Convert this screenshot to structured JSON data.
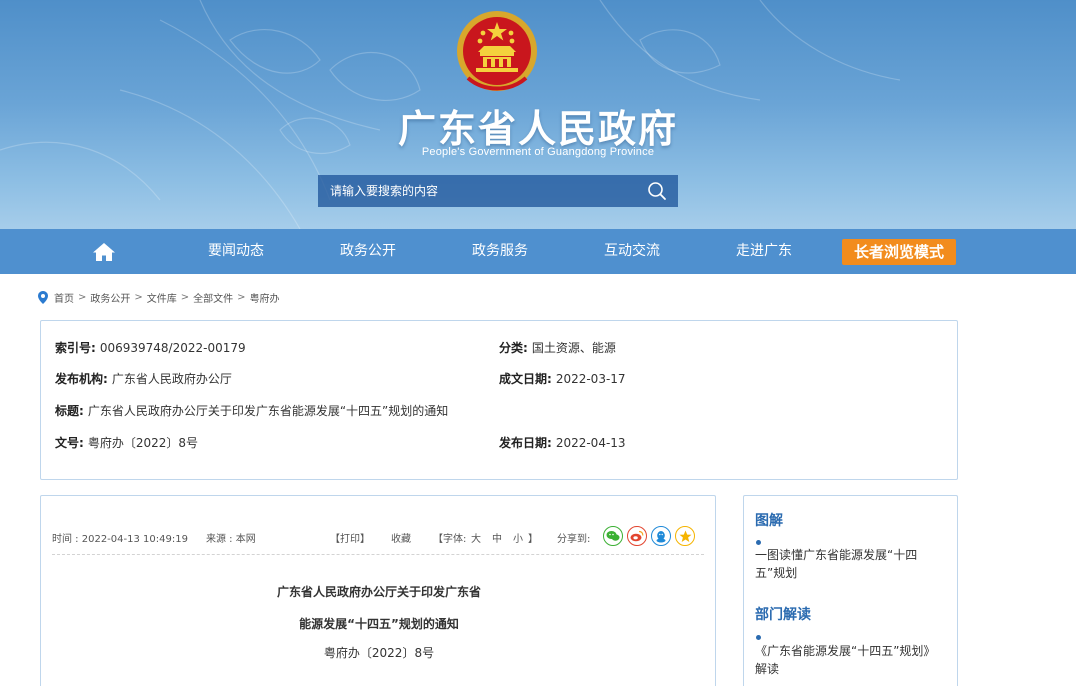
{
  "header": {
    "title": "广东省人民政府",
    "subtitle": "People's Government of Guangdong Province",
    "search_placeholder": "请输入要搜索的内容"
  },
  "nav": {
    "items": [
      "要闻动态",
      "政务公开",
      "政务服务",
      "互动交流",
      "走进广东"
    ],
    "elder_mode": "长者浏览模式"
  },
  "breadcrumb": {
    "items": [
      "首页",
      "政务公开",
      "文件库",
      "全部文件",
      "粤府办"
    ],
    "separator": ">"
  },
  "info": {
    "index_label": "索引号:",
    "index_value": "006939748/2022-00179",
    "category_label": "分类:",
    "category_value": "国土资源、能源",
    "publisher_label": "发布机构:",
    "publisher_value": "广东省人民政府办公厅",
    "written_date_label": "成文日期:",
    "written_date_value": "2022-03-17",
    "title_label": "标题:",
    "title_value": "广东省人民政府办公厅关于印发广东省能源发展“十四五”规划的通知",
    "doc_no_label": "文号:",
    "doc_no_value": "粤府办〔2022〕8号",
    "publish_date_label": "发布日期:",
    "publish_date_value": "2022-04-13"
  },
  "article": {
    "time": "时间 : 2022-04-13 10:49:19",
    "source": "来源 : 本网",
    "print": "【打印】",
    "favorite": "收藏",
    "font_prefix": "【字体:",
    "font_large": "大",
    "font_medium": "中",
    "font_small": "小",
    "font_suffix": "】",
    "share_label": "分享到:",
    "title_line1": "广东省人民政府办公厅关于印发广东省",
    "title_line2": "能源发展“十四五”规划的通知",
    "doc_number": "粤府办〔2022〕8号"
  },
  "side": {
    "section1_title": "图解",
    "section1_link": "一图读懂广东省能源发展“十四五”规划",
    "section2_title": "部门解读",
    "section2_link": "《广东省能源发展“十四五”规划》解读"
  },
  "colors": {
    "nav_bg": "#4f90cf",
    "elder_mode_bg": "#f28c1d",
    "accent_blue": "#2b6bb0",
    "share_wechat": "#3cb034",
    "share_weibo": "#e2452f",
    "share_qq": "#1f8ad8",
    "share_qzone": "#f5b400"
  },
  "icons": {
    "home": "home-icon",
    "search": "search-icon",
    "location": "location-pin-icon",
    "emblem": "national-emblem-icon"
  }
}
